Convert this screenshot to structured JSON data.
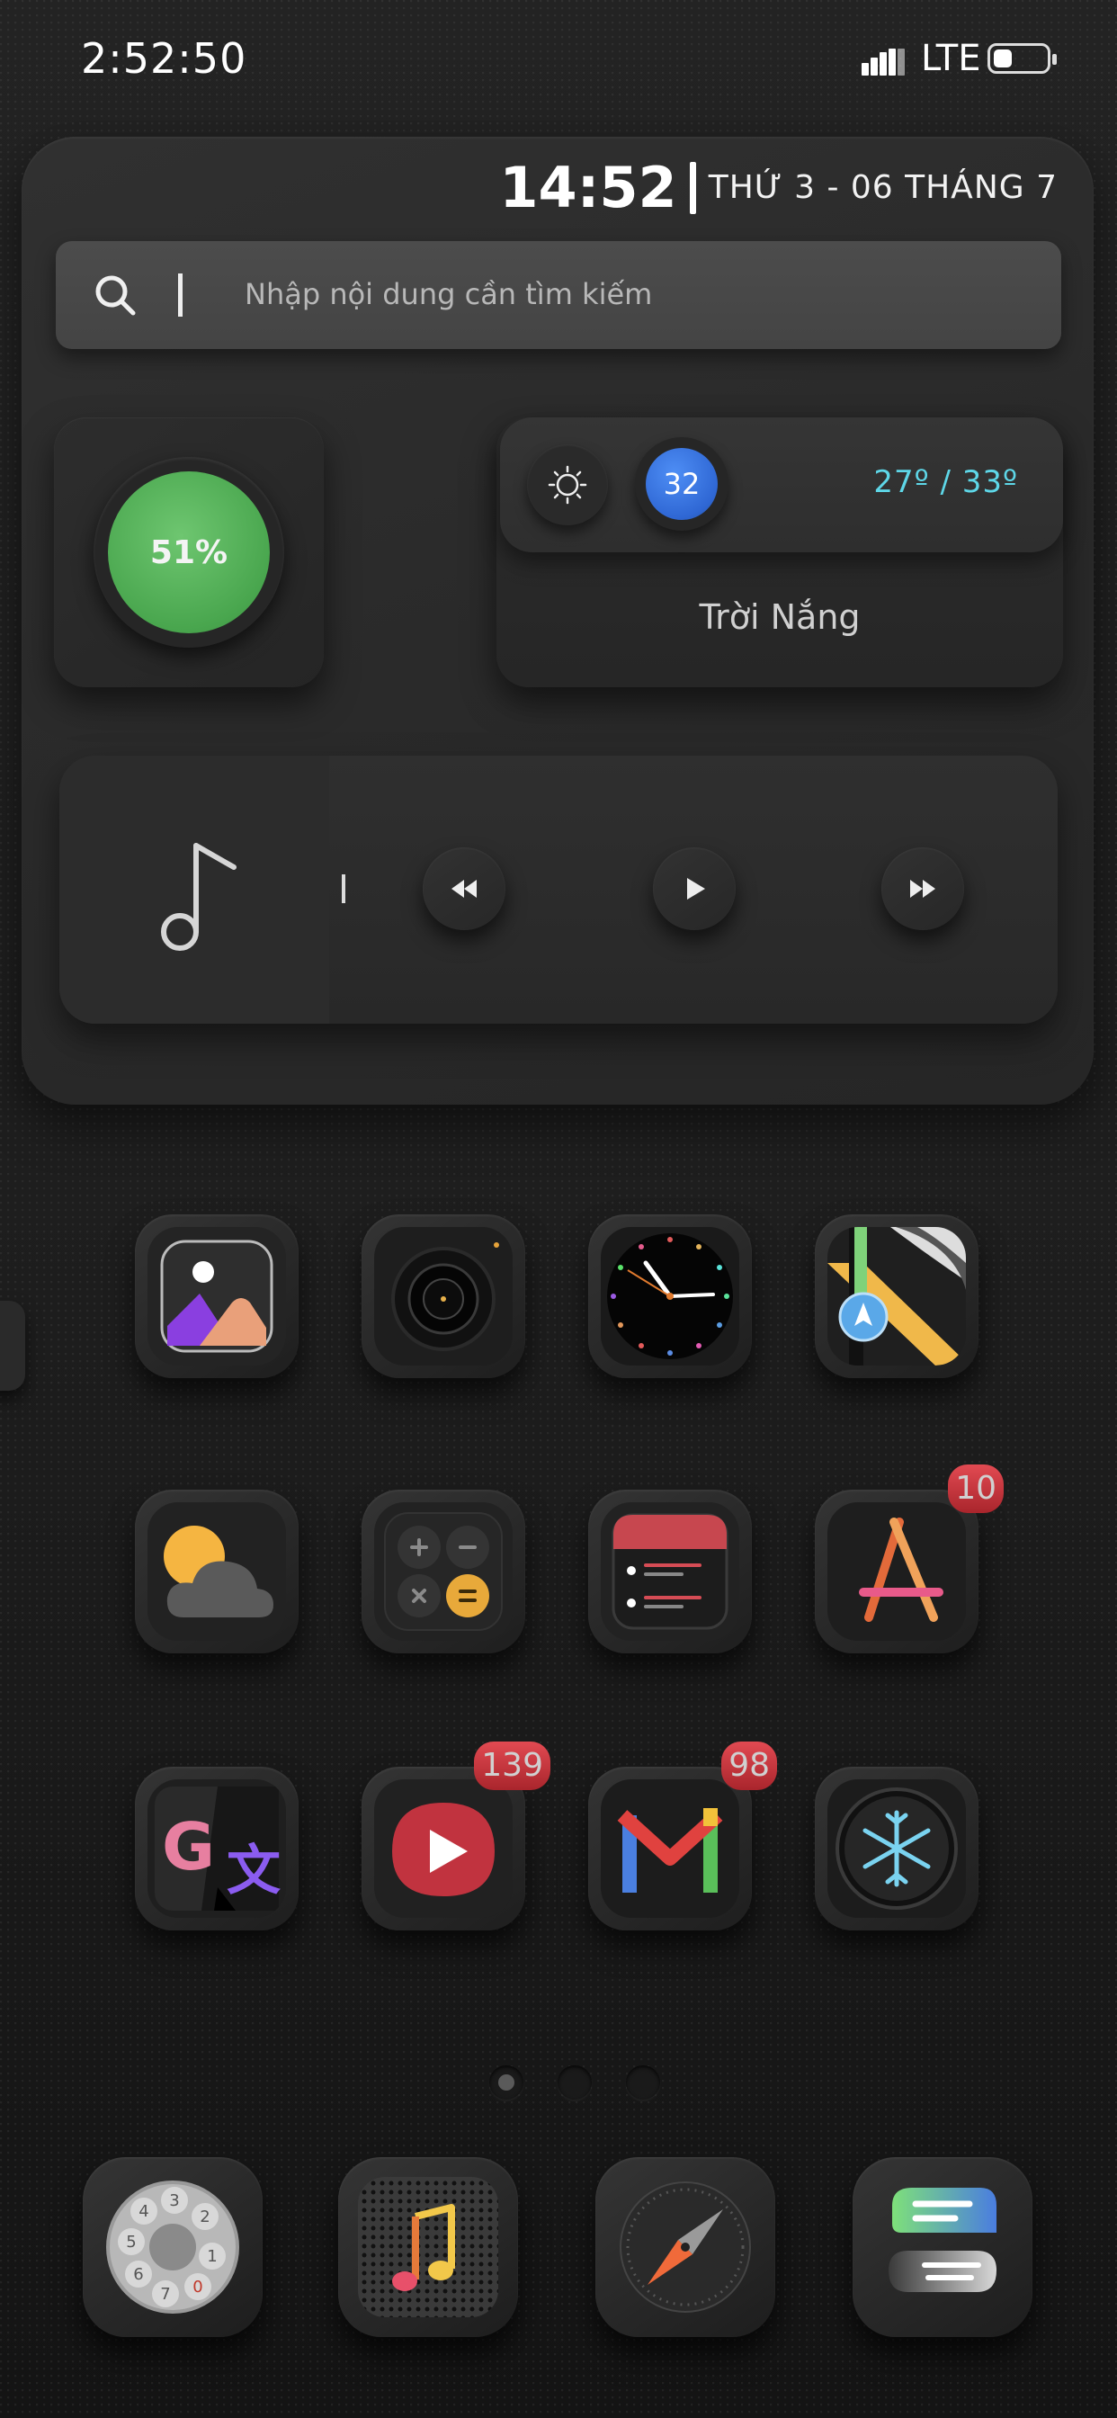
{
  "status_bar": {
    "time": "2:52:50",
    "network": "LTE",
    "battery_level": 0.35
  },
  "widget": {
    "clock": {
      "time": "14:52",
      "date": "THỨ 3 - 06 THÁNG 7"
    },
    "search": {
      "placeholder": "Nhập nội dung cần tìm kiếm",
      "icon": "search-icon"
    },
    "battery": {
      "percent": "51%",
      "color": "#4fae54"
    },
    "weather": {
      "icon": "sun-icon",
      "uv_index": "32",
      "temp_range": "27º / 33º",
      "condition": "Trời Nắng",
      "accent": "#5ed7e8"
    },
    "music": {
      "art_icon": "music-note-icon",
      "controls": [
        "previous-icon",
        "play-icon",
        "next-icon"
      ]
    }
  },
  "apps": [
    {
      "name": "photos",
      "icon": "photos-icon",
      "badge": null
    },
    {
      "name": "camera",
      "icon": "camera-icon",
      "badge": null
    },
    {
      "name": "clock",
      "icon": "clock-icon",
      "badge": null
    },
    {
      "name": "maps",
      "icon": "maps-icon",
      "badge": null
    },
    {
      "name": "weather",
      "icon": "weather-icon",
      "badge": null
    },
    {
      "name": "calculator",
      "icon": "calculator-icon",
      "badge": null
    },
    {
      "name": "reminders",
      "icon": "reminders-icon",
      "badge": null
    },
    {
      "name": "app-store",
      "icon": "app-store-icon",
      "badge": "10"
    },
    {
      "name": "google-translate",
      "icon": "translate-icon",
      "badge": null
    },
    {
      "name": "youtube",
      "icon": "youtube-icon",
      "badge": "139"
    },
    {
      "name": "gmail",
      "icon": "gmail-icon",
      "badge": "98"
    },
    {
      "name": "snowflake",
      "icon": "snowflake-icon",
      "badge": null
    }
  ],
  "page_indicator": {
    "pages": 3,
    "active": 0
  },
  "dock": [
    {
      "name": "phone",
      "icon": "phone-dial-icon",
      "dial_digits": [
        "1",
        "2",
        "3",
        "4",
        "5",
        "6",
        "7",
        "0"
      ]
    },
    {
      "name": "music",
      "icon": "music-icon"
    },
    {
      "name": "safari",
      "icon": "compass-icon"
    },
    {
      "name": "messages",
      "icon": "messages-icon"
    }
  ]
}
